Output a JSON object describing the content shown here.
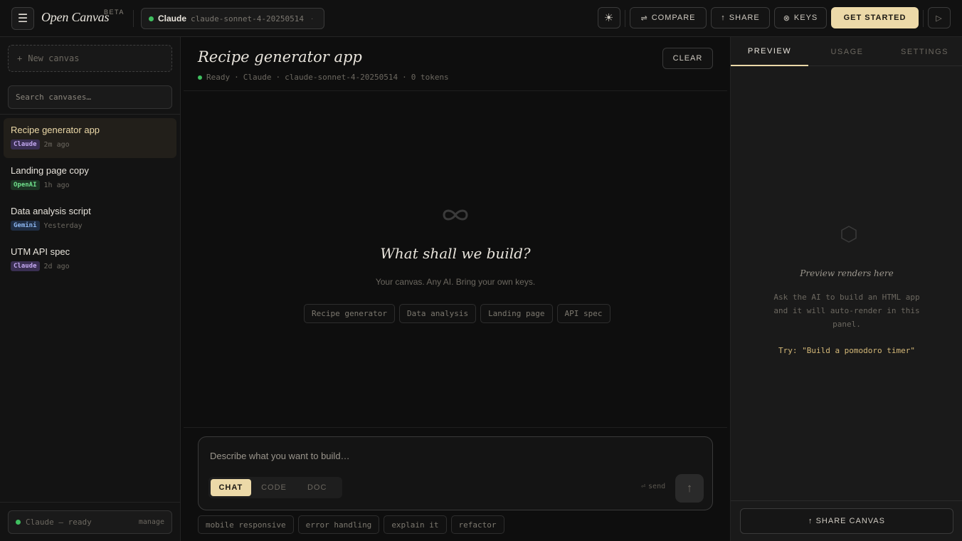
{
  "topbar": {
    "brand": "Open Canvas",
    "beta": "BETA",
    "model_name": "Claude",
    "model_id": "claude-sonnet-4-20250514",
    "model_chev": "·",
    "theme_icon": "☀",
    "compare_icon": "⇌",
    "compare_label": "COMPARE",
    "share_icon": "↑",
    "share_label": "SHARE",
    "keys_icon": "⊗",
    "keys_label": "KEYS",
    "get_started_label": "GET STARTED",
    "run_icon": "▷"
  },
  "sidebar": {
    "new_canvas_icon": "+",
    "new_canvas_label": "New canvas",
    "search_placeholder": "Search canvases…",
    "items": [
      {
        "title": "Recipe generator app",
        "tag": "Claude",
        "time": "2m ago"
      },
      {
        "title": "Landing page copy",
        "tag": "OpenAI",
        "time": "1h ago"
      },
      {
        "title": "Data analysis script",
        "tag": "Gemini",
        "time": "Yesterday"
      },
      {
        "title": "UTM API spec",
        "tag": "Claude",
        "time": "2d ago"
      }
    ],
    "status_text": "Claude — ready",
    "manage_label": "manage"
  },
  "main": {
    "title": "Recipe generator app",
    "status": "Ready",
    "provider": "Claude",
    "model": "claude-sonnet-4-20250514",
    "tokens": "0 tokens",
    "sep": "·",
    "clear_label": "CLEAR",
    "empty_title": "What shall we build?",
    "empty_sub": "Your canvas. Any AI. Bring your own keys.",
    "chips": [
      "Recipe generator",
      "Data analysis",
      "Landing page",
      "API spec"
    ],
    "composer_placeholder": "Describe what you want to build…",
    "modes": [
      "CHAT",
      "CODE",
      "DOC"
    ],
    "send_hint_icon": "⏎",
    "send_hint": "send",
    "send_icon": "↑",
    "quick_chips": [
      "mobile responsive",
      "error handling",
      "explain it",
      "refactor"
    ]
  },
  "preview": {
    "tabs": [
      "PREVIEW",
      "USAGE",
      "SETTINGS"
    ],
    "title": "Preview renders here",
    "desc": "Ask the AI to build an HTML app and it will auto-render in this panel.",
    "try": "Try: \"Build a pomodoro timer\"",
    "share_icon": "↑",
    "share_label": "SHARE CANVAS"
  },
  "colors": {
    "accent": "#ecd9a8",
    "status_green": "#3fbf5f",
    "claude_tag": "#c3a8f0",
    "openai_tag": "#6fe08b",
    "gemini_tag": "#8db6f0"
  }
}
